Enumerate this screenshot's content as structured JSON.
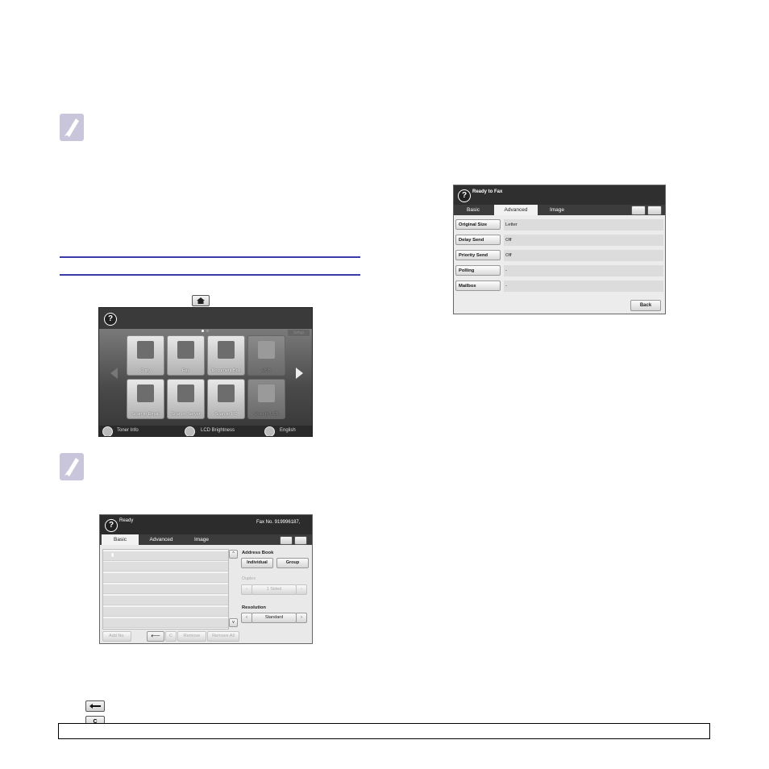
{
  "home_screen": {
    "tiles_row1": [
      "Copy",
      "Fax",
      "Document Box",
      "USB"
    ],
    "tiles_row2": [
      "Scan to Email",
      "Scan to Server",
      "Scan to PC",
      "Scan to USB"
    ],
    "top_right_button": "Setup",
    "status_items": [
      "Toner Info",
      "LCD Brightness",
      "English"
    ]
  },
  "fax_basic_screen": {
    "status": "Ready",
    "fax_no": "Fax No. 919996187,",
    "tabs": [
      "Basic",
      "Advanced",
      "Image"
    ],
    "address_book_label": "Address Book",
    "individual_button": "Individual",
    "group_button": "Group",
    "duplex_label": "Duplex",
    "duplex_value": "1 Sided",
    "resolution_label": "Resolution",
    "resolution_value": "Standard",
    "bottom_buttons": [
      "Add No.",
      "C",
      "Remove",
      "Remove All"
    ]
  },
  "fax_advanced_screen": {
    "status": "Ready to Fax",
    "tabs": [
      "Basic",
      "Advanced",
      "Image"
    ],
    "rows": [
      {
        "label": "Original Size",
        "value": "Letter"
      },
      {
        "label": "Delay Send",
        "value": "Off"
      },
      {
        "label": "Priority Send",
        "value": "Off"
      },
      {
        "label": "Polling",
        "value": "-"
      },
      {
        "label": "Mailbox",
        "value": "-"
      }
    ],
    "back_button": "Back"
  }
}
